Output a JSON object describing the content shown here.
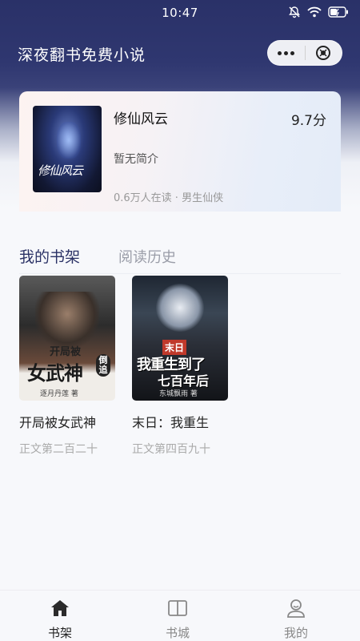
{
  "status_bar": {
    "time": "10:47"
  },
  "nav": {
    "title": "深夜翻书免费小说"
  },
  "featured": {
    "cover_text": "修仙风云",
    "title": "修仙风云",
    "score": "9.7分",
    "description": "暂无简介",
    "meta": "0.6万人在读 · 男生仙侠"
  },
  "tabs": {
    "shelf": "我的书架",
    "history": "阅读历史"
  },
  "books": [
    {
      "cover_top": "开局被",
      "cover_main": "女武神",
      "cover_side": "倒追",
      "cover_author": "逐月丹莲 著",
      "title": "开局被女武神",
      "progress": "正文第二百二十"
    },
    {
      "cover_top": "末日",
      "cover_main": "我重生到了",
      "cover_sub": "七百年后",
      "cover_author": "东城飘雨 著",
      "title": "末日：我重生",
      "progress": "正文第四百九十"
    }
  ],
  "tabbar": [
    {
      "label": "书架",
      "icon": "home-icon"
    },
    {
      "label": "书城",
      "icon": "book-open-icon"
    },
    {
      "label": "我的",
      "icon": "user-icon"
    }
  ]
}
